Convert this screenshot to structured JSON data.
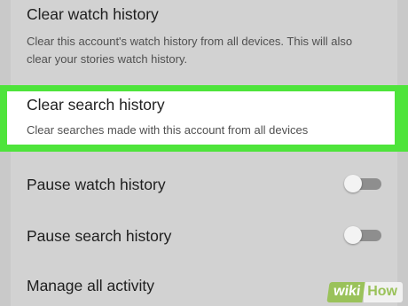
{
  "settings": {
    "watch_history": {
      "title": "Clear watch history",
      "description": "Clear this account's watch history from all devices. This will also clear your stories watch history."
    },
    "search_history": {
      "title": "Clear search history",
      "description": "Clear searches made with this account from all devices"
    },
    "pause_watch": {
      "title": "Pause watch history",
      "enabled": false
    },
    "pause_search": {
      "title": "Pause search history",
      "enabled": false
    },
    "manage_activity": {
      "title": "Manage all activity"
    }
  },
  "colors": {
    "highlight": "#4ee43b",
    "background": "#c9c9c9"
  },
  "watermark": {
    "wiki": "wiki",
    "how": "How"
  }
}
